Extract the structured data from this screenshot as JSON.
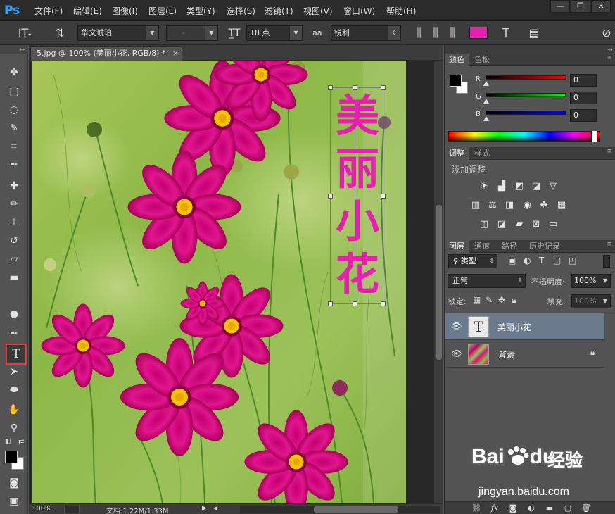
{
  "app": {
    "logo": "Ps",
    "menu": [
      "文件(F)",
      "编辑(E)",
      "图像(I)",
      "图层(L)",
      "类型(Y)",
      "选择(S)",
      "滤镜(T)",
      "视图(V)",
      "窗口(W)",
      "帮助(H)"
    ],
    "window_buttons": [
      "—",
      "❐",
      "✕"
    ]
  },
  "options": {
    "font_family": "华文琥珀",
    "font_style": "-",
    "font_size": "18 点",
    "aa_label": "aa",
    "anti_alias": "锐利",
    "text_color": "#e61fb0"
  },
  "tools": [
    "move-tool",
    "marquee-tool",
    "lasso-tool",
    "quick-select-tool",
    "crop-tool",
    "eyedropper-tool",
    "healing-brush-tool",
    "brush-tool",
    "clone-stamp-tool",
    "history-brush-tool",
    "eraser-tool",
    "gradient-tool",
    "dodge-tool",
    "pen-tool",
    "type-tool",
    "path-select-tool",
    "ellipse-tool",
    "hand-tool",
    "zoom-tool"
  ],
  "document": {
    "tab_title": "5.jpg @ 100% (美丽小花, RGB/8) *",
    "close": "×",
    "canvas_text": [
      "美",
      "丽",
      "小",
      "花"
    ]
  },
  "status": {
    "zoom": "100%",
    "doc_info": "文档:1.22M/1.33M"
  },
  "color_panel": {
    "tabs": [
      "颜色",
      "色板"
    ],
    "channels": [
      {
        "label": "R",
        "value": "0",
        "color": "#ff0000"
      },
      {
        "label": "G",
        "value": "0",
        "color": "#00ff00"
      },
      {
        "label": "B",
        "value": "0",
        "color": "#0000ff"
      }
    ]
  },
  "adjust_panel": {
    "tabs": [
      "调整",
      "样式"
    ],
    "heading": "添加调整",
    "icons": [
      "brightness-icon",
      "levels-icon",
      "curves-icon",
      "exposure-icon",
      "vibrance-icon",
      "hue-sat-icon",
      "color-balance-icon",
      "bw-icon",
      "photo-filter-icon",
      "channel-mixer-icon",
      "color-lookup-icon",
      "invert-icon",
      "posterize-icon",
      "threshold-icon",
      "selective-color-icon",
      "gradient-map-icon"
    ]
  },
  "layers_panel": {
    "tabs": [
      "图层",
      "通道",
      "路径",
      "历史记录"
    ],
    "filter_kind": "类型",
    "blend_mode": "正常",
    "opacity_label": "不透明度:",
    "opacity": "100%",
    "lock_label": "锁定:",
    "fill_label": "填充:",
    "fill": "100%",
    "layers": [
      {
        "name": "美丽小花",
        "thumb": "T",
        "selected": true
      },
      {
        "name": "背景",
        "thumb": "",
        "selected": false
      }
    ]
  },
  "watermark": {
    "brand": "Bai",
    "brand2": "du",
    "brand_cn": "经验",
    "url": "jingyan.baidu.com"
  }
}
